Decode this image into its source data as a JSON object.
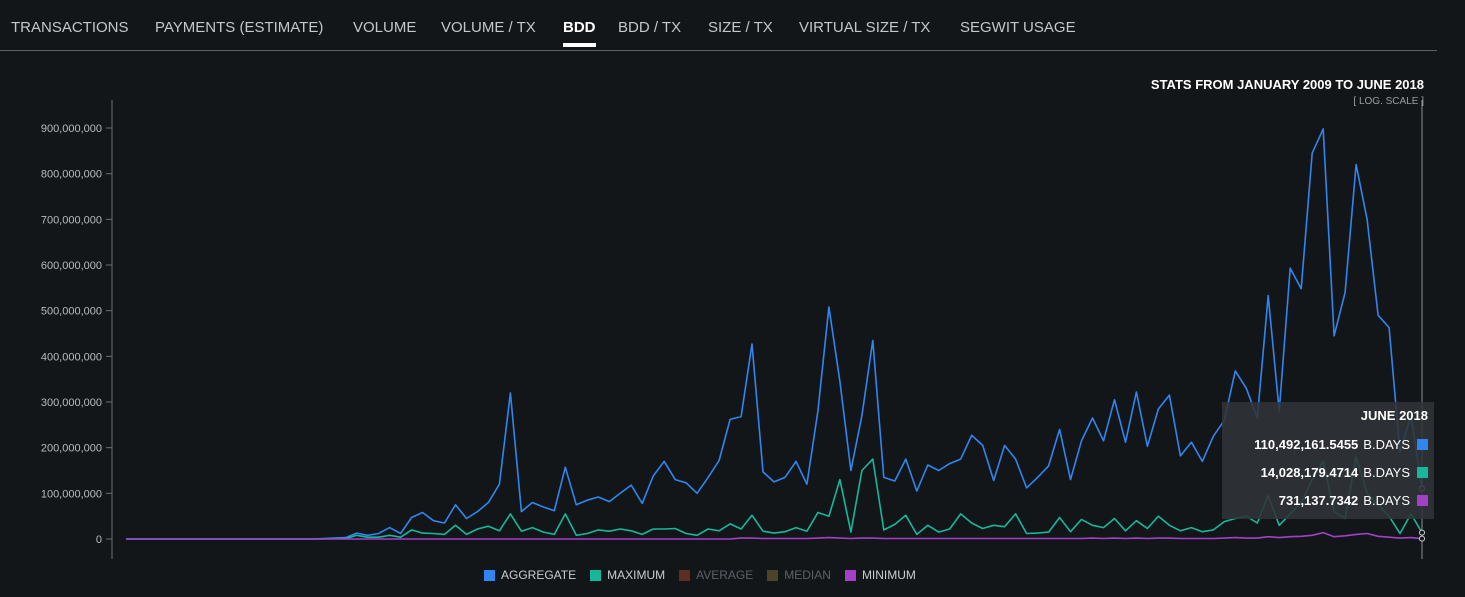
{
  "tabs": [
    {
      "label": "TRANSACTIONS",
      "active": false
    },
    {
      "label": "PAYMENTS (ESTIMATE)",
      "active": false
    },
    {
      "label": "VOLUME",
      "active": false
    },
    {
      "label": "VOLUME / TX",
      "active": false
    },
    {
      "label": "BDD",
      "active": true
    },
    {
      "label": "BDD / TX",
      "active": false
    },
    {
      "label": "SIZE / TX",
      "active": false
    },
    {
      "label": "VIRTUAL SIZE / TX",
      "active": false
    },
    {
      "label": "SEGWIT USAGE",
      "active": false
    }
  ],
  "stats_title": "STATS FROM JANUARY 2009 TO JUNE 2018",
  "log_toggle": "[ LOG. SCALE ]",
  "tooltip": {
    "title": "JUNE 2018",
    "rows": [
      {
        "value": "110,492,161.5455",
        "unit": "B.DAYS",
        "color": "#2f86f0"
      },
      {
        "value": "14,028,179.4714",
        "unit": "B.DAYS",
        "color": "#17b79b"
      },
      {
        "value": "731,137.7342",
        "unit": "B.DAYS",
        "color": "#a43fc9"
      }
    ]
  },
  "legend": [
    {
      "label": "AGGREGATE",
      "color": "#2f86f0",
      "enabled": true
    },
    {
      "label": "MAXIMUM",
      "color": "#17b79b",
      "enabled": true
    },
    {
      "label": "AVERAGE",
      "color": "#5e2d22",
      "enabled": false
    },
    {
      "label": "MEDIAN",
      "color": "#4a4429",
      "enabled": false
    },
    {
      "label": "MINIMUM",
      "color": "#a43fc9",
      "enabled": true
    }
  ],
  "chart_data": {
    "type": "line",
    "x_start": "2009-01",
    "x_end": "2018-06",
    "ylim": [
      0,
      950000000
    ],
    "yticks": [
      0,
      100000000,
      200000000,
      300000000,
      400000000,
      500000000,
      600000000,
      700000000,
      800000000,
      900000000
    ],
    "ytick_labels": [
      "0",
      "100,000,000",
      "200,000,000",
      "300,000,000",
      "400,000,000",
      "500,000,000",
      "600,000,000",
      "700,000,000",
      "800,000,000",
      "900,000,000"
    ],
    "grid": false,
    "series": [
      {
        "name": "AGGREGATE",
        "color": "#2f86f0",
        "values": [
          0,
          0,
          0,
          0,
          0,
          0,
          0,
          0,
          0,
          0,
          0,
          0,
          0,
          0,
          0,
          0,
          0,
          0,
          1000000,
          2000000,
          3000000,
          13000000,
          8000000,
          12000000,
          25000000,
          12000000,
          47000000,
          58000000,
          40000000,
          35000000,
          75000000,
          45000000,
          60000000,
          80000000,
          120000000,
          320000000,
          60000000,
          80000000,
          70000000,
          62000000,
          157000000,
          75000000,
          85000000,
          92000000,
          82000000,
          100000000,
          118000000,
          78000000,
          138000000,
          170000000,
          130000000,
          123000000,
          100000000,
          135000000,
          172000000,
          262000000,
          268000000,
          427000000,
          147000000,
          125000000,
          135000000,
          170000000,
          120000000,
          280000000,
          508000000,
          345000000,
          150000000,
          270000000,
          435000000,
          135000000,
          127000000,
          175000000,
          105000000,
          162000000,
          150000000,
          165000000,
          175000000,
          227000000,
          205000000,
          128000000,
          205000000,
          175000000,
          112000000,
          135000000,
          160000000,
          240000000,
          130000000,
          215000000,
          265000000,
          215000000,
          305000000,
          212000000,
          322000000,
          203000000,
          285000000,
          315000000,
          182000000,
          212000000,
          170000000,
          225000000,
          260000000,
          368000000,
          330000000,
          265000000,
          533000000,
          280000000,
          593000000,
          548000000,
          845000000,
          898000000,
          445000000,
          540000000,
          820000000,
          700000000,
          490000000,
          463000000,
          190000000,
          270000000,
          110492161.5455
        ]
      },
      {
        "name": "MAXIMUM",
        "color": "#17b79b",
        "values": [
          0,
          0,
          0,
          0,
          0,
          0,
          0,
          0,
          0,
          0,
          0,
          0,
          0,
          0,
          0,
          0,
          0,
          0,
          0,
          1000000,
          500000,
          8000000,
          4000000,
          4000000,
          8000000,
          4000000,
          20000000,
          13000000,
          12000000,
          10000000,
          30000000,
          10000000,
          22000000,
          28000000,
          18000000,
          55000000,
          17000000,
          25000000,
          15000000,
          10000000,
          55000000,
          8000000,
          12000000,
          20000000,
          17000000,
          22000000,
          18000000,
          10000000,
          22000000,
          22000000,
          23000000,
          12000000,
          8000000,
          22000000,
          18000000,
          33000000,
          22000000,
          52000000,
          17000000,
          13000000,
          16000000,
          25000000,
          17000000,
          58000000,
          50000000,
          130000000,
          15000000,
          150000000,
          175000000,
          20000000,
          32000000,
          52000000,
          10000000,
          30000000,
          15000000,
          22000000,
          55000000,
          35000000,
          23000000,
          30000000,
          27000000,
          55000000,
          12000000,
          13000000,
          15000000,
          47000000,
          16000000,
          43000000,
          30000000,
          25000000,
          45000000,
          18000000,
          40000000,
          23000000,
          50000000,
          30000000,
          18000000,
          25000000,
          16000000,
          20000000,
          38000000,
          45000000,
          50000000,
          35000000,
          95000000,
          30000000,
          55000000,
          80000000,
          130000000,
          170000000,
          60000000,
          45000000,
          180000000,
          100000000,
          75000000,
          50000000,
          12000000,
          55000000,
          14028179.4714
        ]
      },
      {
        "name": "MINIMUM",
        "color": "#a43fc9",
        "values": [
          0,
          0,
          0,
          0,
          0,
          0,
          0,
          0,
          0,
          0,
          0,
          0,
          0,
          0,
          0,
          0,
          0,
          0,
          0,
          0,
          0,
          0,
          0,
          0,
          0,
          0,
          0,
          0,
          0,
          0,
          0,
          0,
          0,
          0,
          0,
          0,
          0,
          0,
          0,
          0,
          0,
          0,
          0,
          0,
          0,
          0,
          0,
          0,
          0,
          0,
          0,
          0,
          0,
          0,
          0,
          0,
          2000000,
          2000000,
          1000000,
          1000000,
          1000000,
          1000000,
          1000000,
          2000000,
          3000000,
          2000000,
          1000000,
          2000000,
          2000000,
          1000000,
          1000000,
          1000000,
          1000000,
          1000000,
          1000000,
          1000000,
          1000000,
          1000000,
          1000000,
          1000000,
          1000000,
          1000000,
          1000000,
          1000000,
          1000000,
          1000000,
          1000000,
          1000000,
          2000000,
          1000000,
          2000000,
          1000000,
          2000000,
          1000000,
          2000000,
          2000000,
          1000000,
          1000000,
          1000000,
          1000000,
          2000000,
          3000000,
          2000000,
          2000000,
          5000000,
          3000000,
          5000000,
          6000000,
          8000000,
          14000000,
          5000000,
          7000000,
          10000000,
          12000000,
          6000000,
          4000000,
          2000000,
          3000000,
          731137.7342
        ]
      }
    ]
  }
}
